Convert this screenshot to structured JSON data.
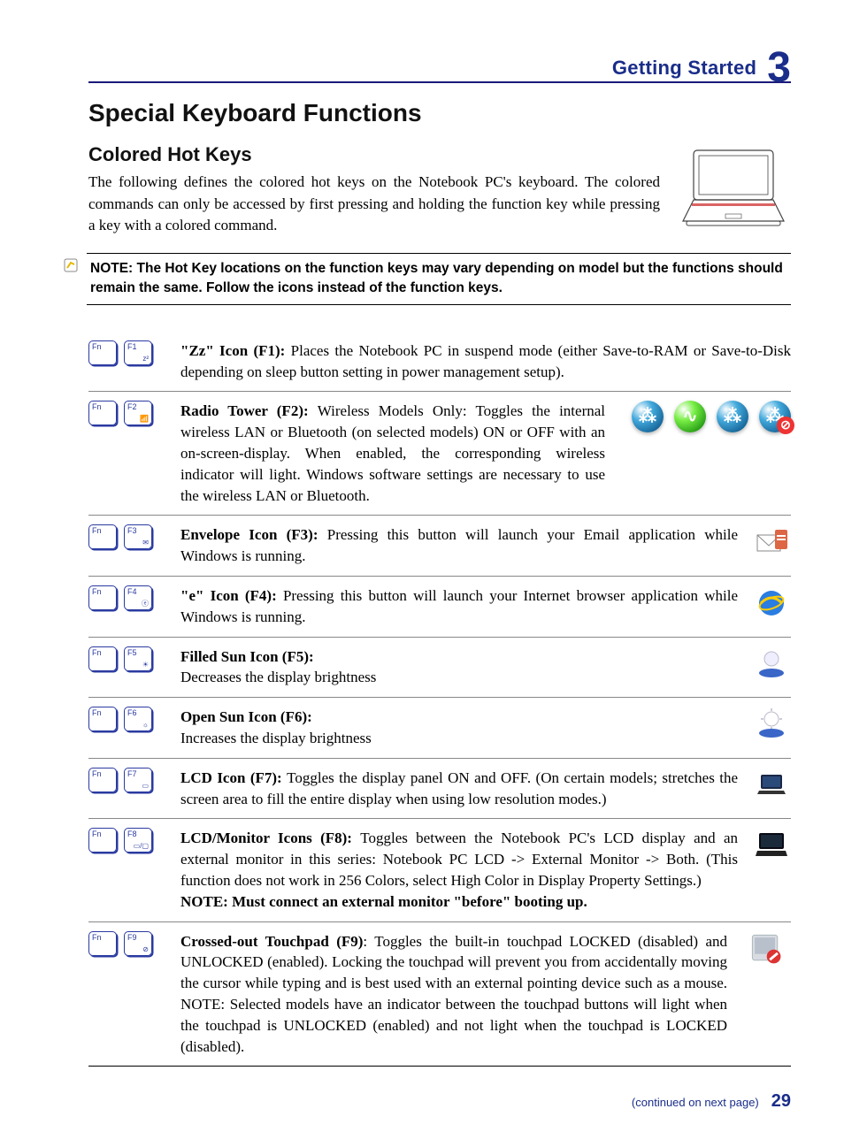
{
  "header": {
    "section": "Getting Started",
    "chapter": "3"
  },
  "h1": "Special Keyboard Functions",
  "h2": "Colored Hot Keys",
  "intro": "The following defines the colored hot keys on the Notebook PC's keyboard. The colored commands can only be accessed by first pressing and holding the function key while pressing a key with a colored command.",
  "note": "NOTE: The Hot Key locations on the function keys may vary depending on model but the functions should remain the same. Follow the icons instead of the function keys.",
  "keys": {
    "fn": "Fn",
    "f1": "F1",
    "f1sub": "z²",
    "f2": "F2",
    "f2sub": "📶",
    "f3": "F3",
    "f3sub": "✉",
    "f4": "F4",
    "f4sub": "ⓔ",
    "f5": "F5",
    "f5sub": "☀",
    "f6": "F6",
    "f6sub": "☼",
    "f7": "F7",
    "f7sub": "▭",
    "f8": "F8",
    "f8sub": "▭/▢",
    "f9": "F9",
    "f9sub": "⊘"
  },
  "rows": {
    "f1": {
      "lead": "\"Zz\" Icon (F1): ",
      "body": "Places the Notebook PC in suspend mode (either Save-to-RAM or Save-to-Disk depending on sleep button setting in power management setup)."
    },
    "f2": {
      "lead": "Radio Tower (F2): ",
      "body": "Wireless Models Only: Toggles the internal wireless LAN or Bluetooth (on selected models) ON or OFF with an on-screen-display. When enabled, the corresponding wireless indicator will light. Windows software settings are necessary to use the wireless LAN or Bluetooth."
    },
    "f3": {
      "lead": "Envelope Icon (F3): ",
      "body": "Pressing this button will launch your Email application while Windows is running."
    },
    "f4": {
      "lead": "\"e\" Icon (F4): ",
      "body": "Pressing this button will launch your Internet browser application while Windows is running."
    },
    "f5": {
      "lead": "Filled Sun Icon (F5):",
      "body": "Decreases the display brightness"
    },
    "f6": {
      "lead": "Open Sun Icon (F6):",
      "body": "Increases the display brightness"
    },
    "f7": {
      "lead": "LCD Icon (F7): ",
      "body": "Toggles the display panel ON and OFF. (On certain models; stretches the screen area to fill the entire display when using low resolution modes.)"
    },
    "f8": {
      "lead": "LCD/Monitor Icons (F8): ",
      "body": "Toggles between the Notebook PC's LCD display and an external monitor in this series: Notebook PC LCD -> External Monitor -> Both. (This function does not work in 256 Colors, select High Color in Display Property Settings.)",
      "subnote": "NOTE: Must connect an external monitor \"before\" booting up."
    },
    "f9": {
      "lead": "Crossed-out Touchpad (F9)",
      "body": ": Toggles the built-in touchpad LOCKED (disabled) and UNLOCKED (enabled). Locking the touchpad will prevent you from accidentally moving the cursor while typing and is best used with an external pointing device such as a mouse. NOTE: Selected models have an indicator between the touchpad buttons will light when the touchpad is UNLOCKED (enabled) and not light when the touchpad is LOCKED (disabled)."
    }
  },
  "footer": {
    "continued": "(continued on next page)",
    "page": "29"
  }
}
